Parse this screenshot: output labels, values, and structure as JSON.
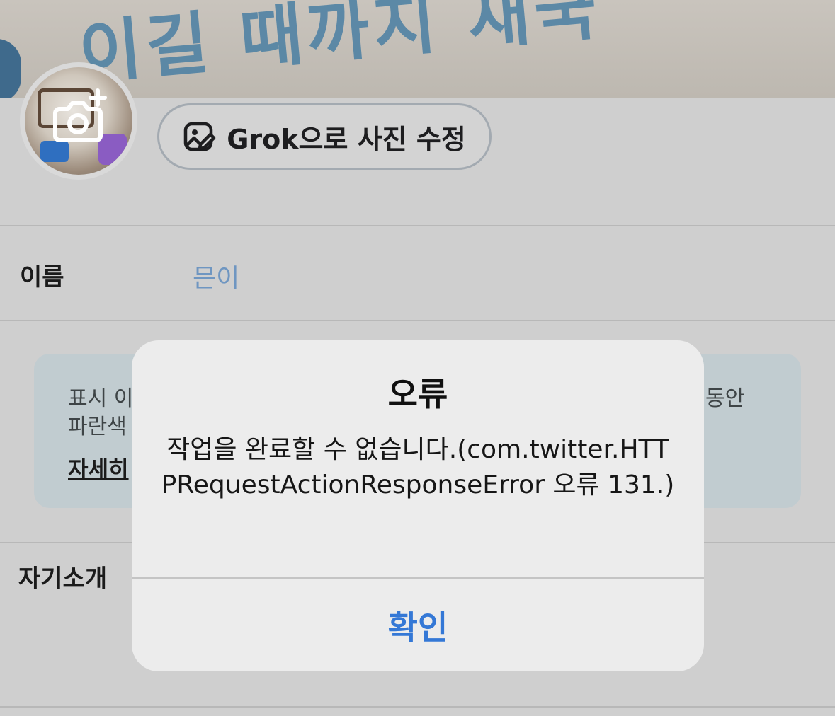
{
  "banner": {
    "text": "이길 때까지 재국"
  },
  "avatar": {
    "alt": "profile photo",
    "camera_icon": "camera-plus-icon"
  },
  "grok_button": {
    "label": "Grok으로 사진 수정",
    "icon": "image-edit-icon"
  },
  "name_row": {
    "label": "이름",
    "value": "믄이"
  },
  "info": {
    "line1_start": "표시 이",
    "line1_end": "동안",
    "line2_start": "파란색",
    "link": "자세히"
  },
  "bio_row": {
    "label": "자기소개"
  },
  "alert": {
    "title": "오류",
    "message": "작업을 완료할 수 없습니다.(com.twitter.HTTPRequestActionResponseError 오류 131.)",
    "button": "확인"
  },
  "colors": {
    "accent": "#3478d6",
    "name_value": "#6f96c1",
    "info_bg": "#c1ccd0"
  }
}
